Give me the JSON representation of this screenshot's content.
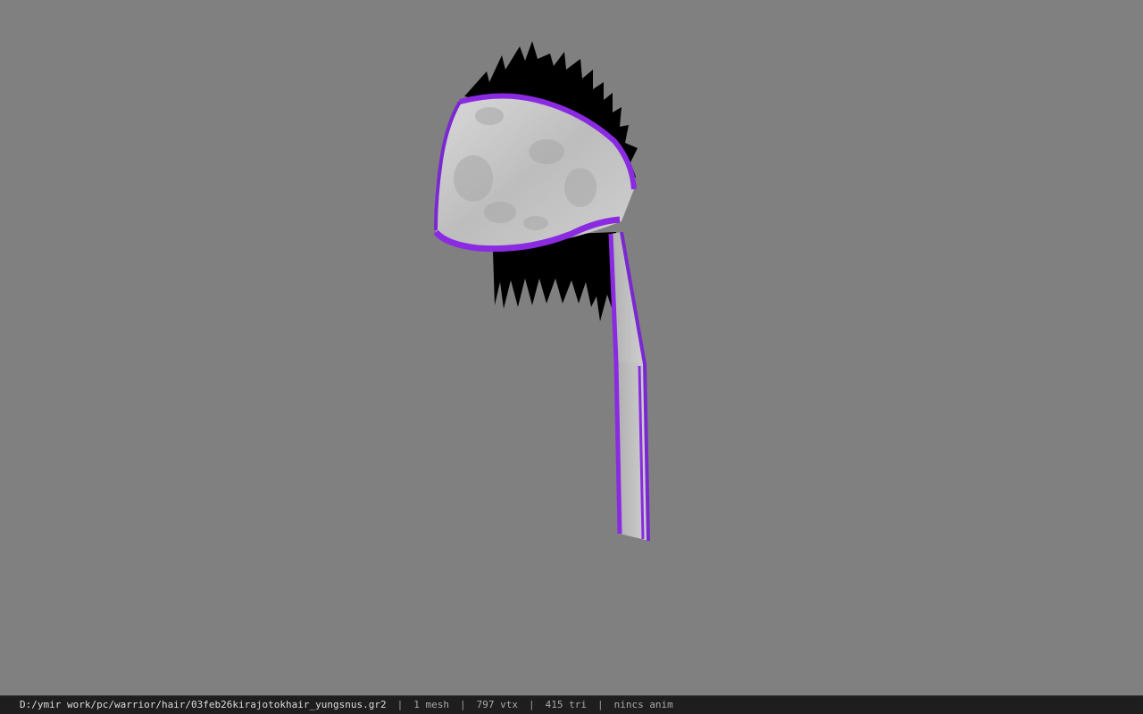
{
  "viewer": {
    "background_color": "#808080",
    "model": {
      "subject": "hair mesh with purple-trimmed headband",
      "trim_color": "#8a2be2",
      "hair_color": "#000000",
      "cloth_color": "#c8c8c8"
    }
  },
  "statusbar": {
    "file_path": "D:/ymir work/pc/warrior/hair/03feb26kirajotokhair_yungsnus.gr2",
    "mesh_count": "1 mesh",
    "vertex_count": "797 vtx",
    "triangle_count": "415 tri",
    "animation": "nincs anim",
    "separator": "|"
  }
}
